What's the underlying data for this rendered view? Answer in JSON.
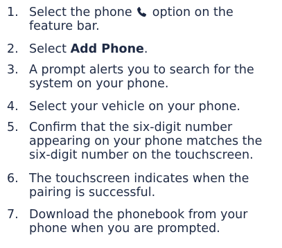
{
  "steps": [
    {
      "number": "1.",
      "text_before_icon": "Select the phone",
      "icon": "phone-handset-icon",
      "text_after_icon": "option on the feature bar."
    },
    {
      "number": "2.",
      "text_before_bold": "Select",
      "bold": "Add Phone",
      "text_after_bold": "."
    },
    {
      "number": "3.",
      "text": "A prompt alerts you to search for the system on your phone."
    },
    {
      "number": "4.",
      "text": "Select your vehicle on your phone."
    },
    {
      "number": "5.",
      "text": "Confirm that the six-digit number appearing on your phone matches the six-digit number on the touchscreen."
    },
    {
      "number": "6.",
      "text": "The touchscreen indicates when the pairing is successful."
    },
    {
      "number": "7.",
      "text": "Download the phonebook from your phone when you are prompted."
    }
  ],
  "colors": {
    "text": "#1e2a44",
    "background": "#ffffff"
  }
}
